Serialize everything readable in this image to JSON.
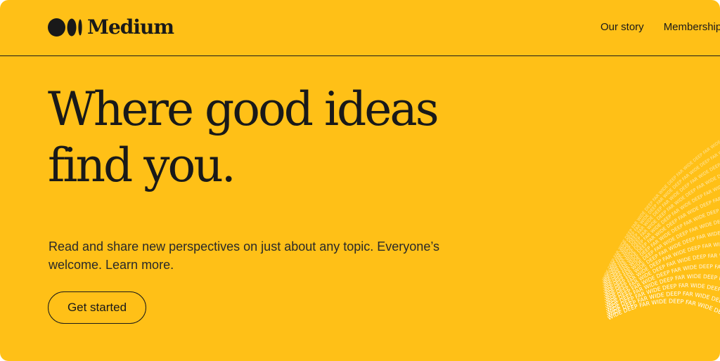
{
  "header": {
    "logo_text": "Medium",
    "logo_icon": "medium-logo-icon",
    "nav": [
      {
        "label": "Our story"
      },
      {
        "label": "Membership"
      }
    ]
  },
  "hero": {
    "headline_line1": "Where good ideas",
    "headline_line2": "find you.",
    "subtitle": "Read and share new perspectives on just about any topic. Everyone’s welcome. Learn more.",
    "cta_label": "Get started"
  },
  "art": {
    "word_pattern": "WIDE DEEP FAR",
    "icon": "word-wave-illustration"
  },
  "colors": {
    "background": "#FFC017",
    "text": "#191919",
    "art_text": "#FFFFFF"
  }
}
